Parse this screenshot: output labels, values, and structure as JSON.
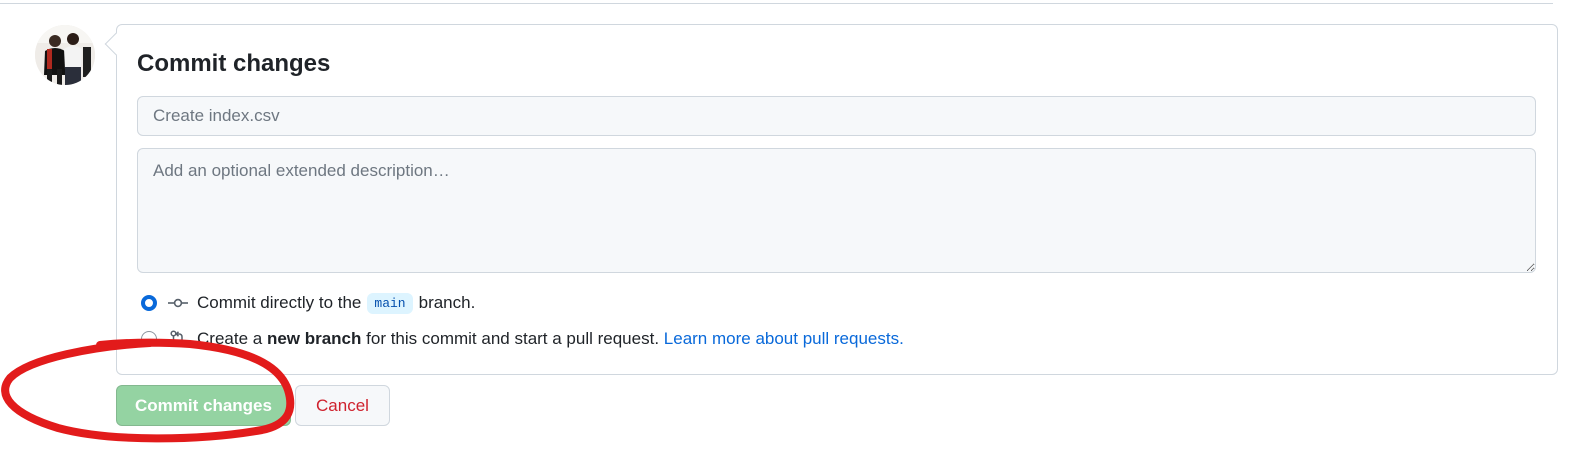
{
  "avatar": {
    "alt": "User avatar"
  },
  "commit_form": {
    "title": "Commit changes",
    "summary": {
      "placeholder": "Create index.csv",
      "value": ""
    },
    "description": {
      "placeholder": "Add an optional extended description…",
      "value": ""
    },
    "options": [
      {
        "selected": true,
        "icon": "git-commit-icon",
        "text_before": "Commit directly to the",
        "branch": "main",
        "text_after": "branch."
      },
      {
        "selected": false,
        "icon": "git-pull-request-icon",
        "text_before": "Create a",
        "bold": "new branch",
        "text_after": "for this commit and start a pull request.",
        "link": "Learn more about pull requests."
      }
    ]
  },
  "actions": {
    "commit_label": "Commit changes",
    "commit_enabled": false,
    "cancel_label": "Cancel"
  },
  "annotation": {
    "shape": "hand-drawn circle",
    "color": "#e21b1b",
    "target": "commit-changes-button"
  },
  "colors": {
    "primary_disabled": "#94d3a2",
    "danger_text": "#cf222e",
    "link": "#0969da",
    "radio_checked": "#0969da",
    "border": "#d0d7de",
    "input_bg": "#f6f8fa",
    "code_bg": "#ddf4ff"
  }
}
